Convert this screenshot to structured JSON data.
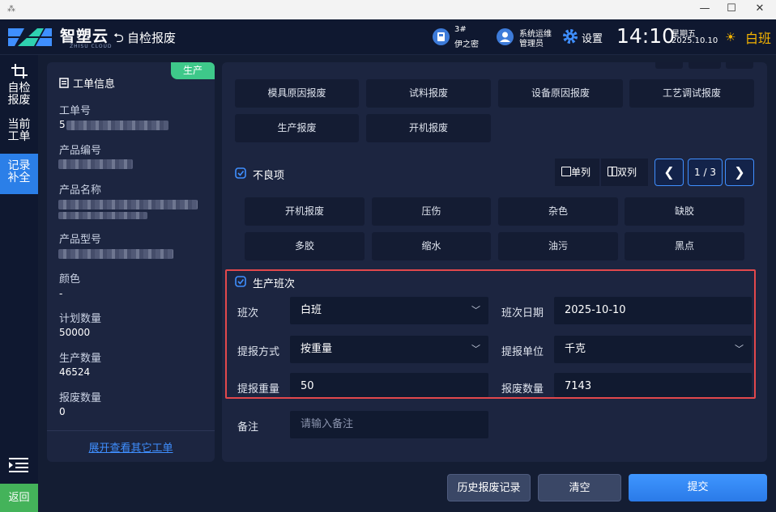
{
  "window": {
    "minimize": "—",
    "maximize": "☐",
    "close": "✕"
  },
  "header": {
    "brand": "智塑云",
    "brand_sub": "ZHISU CLOUD",
    "page_title": "自检报废",
    "machine": {
      "name": "3#",
      "mold": "伊之密"
    },
    "user": {
      "name": "系统运维",
      "role": "管理员"
    },
    "settings_label": "设置",
    "time": "14:10",
    "weekday": "星期五",
    "date": "2025.10.10",
    "shift": "白班"
  },
  "nav": {
    "items": [
      {
        "label": "自检报废"
      },
      {
        "label": "当前工单"
      },
      {
        "label": "记录补全"
      }
    ],
    "return_label": "返回"
  },
  "order_panel": {
    "status_badge": "生产",
    "title": "工单信息",
    "fields": [
      {
        "label": "工单号",
        "value": "5"
      },
      {
        "label": "产品编号",
        "value": ""
      },
      {
        "label": "产品名称",
        "value": ""
      },
      {
        "label": "产品型号",
        "value": ""
      },
      {
        "label": "颜色",
        "value": "-"
      },
      {
        "label": "计划数量",
        "value": "50000"
      },
      {
        "label": "生产数量",
        "value": "46524"
      },
      {
        "label": "报废数量",
        "value": "0"
      }
    ],
    "expand_link": "展开查看其它工单"
  },
  "scrap_types": [
    "模具原因报废",
    "试料报废",
    "设备原因报废",
    "工艺调试报废",
    "生产报废",
    "开机报废"
  ],
  "defects": {
    "title": "不良项",
    "single_col": "单列",
    "double_col": "双列",
    "page": "1 / 3",
    "items": [
      "开机报废",
      "压伤",
      "杂色",
      "缺胶",
      "多胶",
      "缩水",
      "油污",
      "黑点"
    ]
  },
  "shift_section": {
    "title": "生产班次",
    "shift_label": "班次",
    "shift_value": "白班",
    "date_label": "班次日期",
    "date_value": "2025-10-10",
    "method_label": "提报方式",
    "method_value": "按重量",
    "unit_label": "提报单位",
    "unit_value": "千克",
    "weight_label": "提报重量",
    "weight_value": "50",
    "qty_label": "报废数量",
    "qty_value": "7143"
  },
  "remark": {
    "label": "备注",
    "placeholder": "请输入备注"
  },
  "actions": {
    "history": "历史报废记录",
    "clear": "清空",
    "submit": "提交"
  }
}
